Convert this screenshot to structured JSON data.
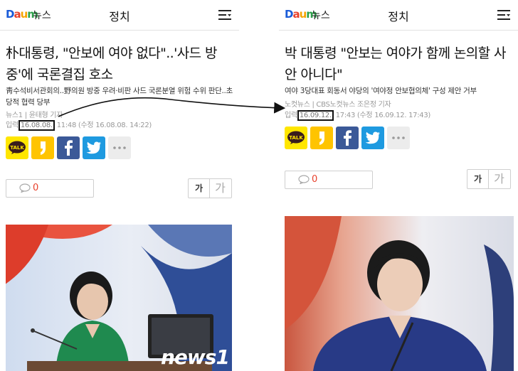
{
  "left": {
    "header": {
      "logo": "Daum",
      "logo_sub": "뉴스",
      "section": "정치"
    },
    "headline": "朴대통령, \"안보에 여야 없다\"..'사드 방중'에 국론결집 호소",
    "subtitle": "靑수석비서관회의..野의원 방중 우려·비판 사드 국론분열 위험 수위 판단..초당적 협력 당부",
    "byline": "뉴스1 | 윤태형 기자",
    "date_prefix": "입력",
    "date_highlight": "16.08.08.",
    "date_rest": "11:48 (수정 16.08.08. 14:22)",
    "comments": "0",
    "font_small": "가",
    "font_large": "가",
    "watermark": "news1"
  },
  "right": {
    "header": {
      "logo": "Daum",
      "logo_sub": "뉴스",
      "section": "정치"
    },
    "headline": "박 대통령 \"안보는 여야가 함께 논의할 사안 아니다\"",
    "subtitle": "여야 3당대표 회동서 야당의 '여야정 안보협의체' 구성 제안 거부",
    "byline": "노컷뉴스 | CBS노컷뉴스 조은정 기자",
    "date_prefix": "입력",
    "date_highlight": "16.09.12.",
    "date_rest": "17:43 (수정 16.09.12. 17:43)",
    "comments": "0",
    "font_small": "가",
    "font_large": "가"
  },
  "icons": {
    "talk": "kakaotalk-icon",
    "story": "kakaostory-icon",
    "facebook": "facebook-icon",
    "twitter": "twitter-icon",
    "more": "more-icon",
    "menu": "menu-icon",
    "comment": "comment-icon"
  },
  "colors": {
    "daum_blue": "#1a5bd8",
    "kakao_yellow": "#ffe600",
    "facebook": "#3b5998",
    "twitter": "#1e9ae0",
    "comment_red": "#e8412c"
  }
}
